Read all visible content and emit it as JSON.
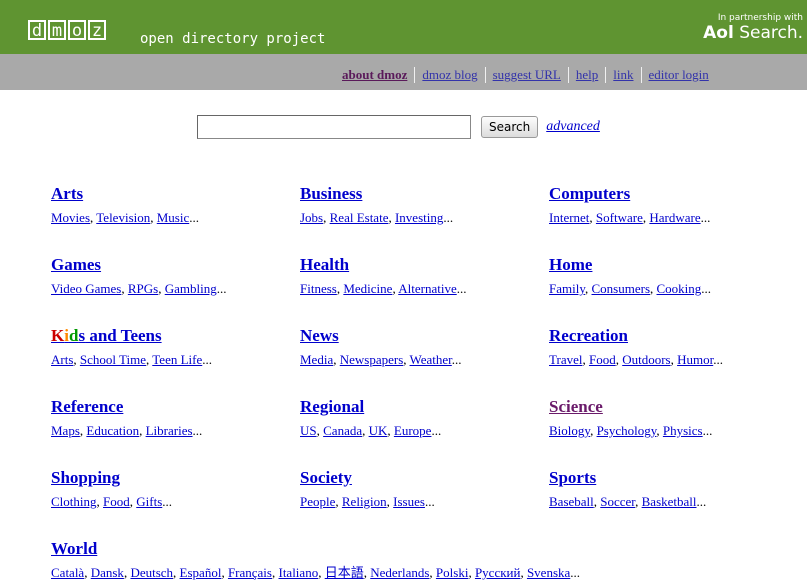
{
  "header": {
    "logo_letters": [
      "d",
      "m",
      "o",
      "z"
    ],
    "logo_text": "open directory project",
    "partner_small": "In partnership with",
    "partner_brand": "Aol",
    "partner_brand_rest": "Search."
  },
  "nav": {
    "items": [
      "about dmoz",
      "dmoz blog",
      "suggest URL",
      "help",
      "link",
      "editor login"
    ]
  },
  "search": {
    "button_label": "Search",
    "advanced_label": "advanced",
    "value": ""
  },
  "categories": [
    {
      "title": "Arts",
      "subs": [
        "Movies",
        "Television",
        "Music"
      ]
    },
    {
      "title": "Business",
      "subs": [
        "Jobs",
        "Real Estate",
        "Investing"
      ]
    },
    {
      "title": "Computers",
      "subs": [
        "Internet",
        "Software",
        "Hardware"
      ]
    },
    {
      "title": "Games",
      "subs": [
        "Video Games",
        "RPGs",
        "Gambling"
      ]
    },
    {
      "title": "Health",
      "subs": [
        "Fitness",
        "Medicine",
        "Alternative"
      ]
    },
    {
      "title": "Home",
      "subs": [
        "Family",
        "Consumers",
        "Cooking"
      ]
    },
    {
      "title_kids": [
        "K",
        "i",
        "d",
        "s"
      ],
      "title": " and Teens",
      "subs": [
        "Arts",
        "School Time",
        "Teen Life"
      ]
    },
    {
      "title": "News",
      "subs": [
        "Media",
        "Newspapers",
        "Weather"
      ]
    },
    {
      "title": "Recreation",
      "subs": [
        "Travel",
        "Food",
        "Outdoors",
        "Humor"
      ]
    },
    {
      "title": "Reference",
      "subs": [
        "Maps",
        "Education",
        "Libraries"
      ]
    },
    {
      "title": "Regional",
      "subs": [
        "US",
        "Canada",
        "UK",
        "Europe"
      ]
    },
    {
      "title": "Science",
      "subs": [
        "Biology",
        "Psychology",
        "Physics"
      ]
    },
    {
      "title": "Shopping",
      "subs": [
        "Clothing",
        "Food",
        "Gifts"
      ]
    },
    {
      "title": "Society",
      "subs": [
        "People",
        "Religion",
        "Issues"
      ]
    },
    {
      "title": "Sports",
      "subs": [
        "Baseball",
        "Soccer",
        "Basketball"
      ]
    },
    {
      "title": "World",
      "subs": [
        "Català",
        "Dansk",
        "Deutsch",
        "Español",
        "Français",
        "Italiano",
        "日本語",
        "Nederlands",
        "Polski",
        "Русский",
        "Svenska"
      ]
    }
  ],
  "ellipsis": "...",
  "comma": ", "
}
